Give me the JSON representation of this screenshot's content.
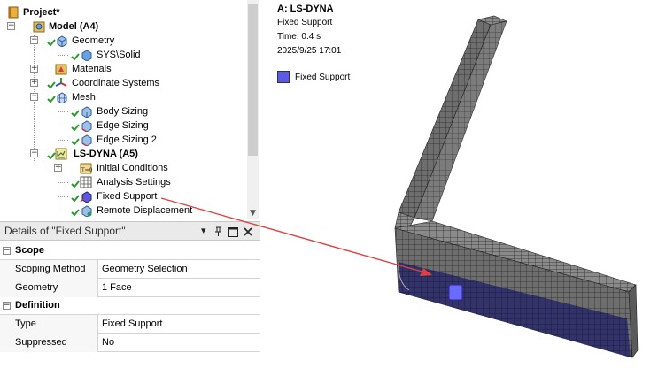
{
  "tree": {
    "items": [
      {
        "label": "Project*",
        "bold": true
      },
      {
        "label": "Model (A4)",
        "bold": true
      },
      {
        "label": "Geometry"
      },
      {
        "label": "SYS\\Solid"
      },
      {
        "label": "Materials"
      },
      {
        "label": "Coordinate Systems"
      },
      {
        "label": "Mesh"
      },
      {
        "label": "Body Sizing"
      },
      {
        "label": "Edge Sizing"
      },
      {
        "label": "Edge Sizing 2"
      },
      {
        "label": "LS-DYNA (A5)",
        "bold": true
      },
      {
        "label": "Initial Conditions"
      },
      {
        "label": "Analysis Settings"
      },
      {
        "label": "Fixed Support"
      },
      {
        "label": "Remote Displacement"
      }
    ]
  },
  "details": {
    "title": "Details of \"Fixed Support\"",
    "pin_icon": "pin-icon",
    "groups": [
      {
        "name": "Scope",
        "rows": [
          {
            "label": "Scoping Method",
            "value": "Geometry Selection"
          },
          {
            "label": "Geometry",
            "value": "1 Face"
          }
        ]
      },
      {
        "name": "Definition",
        "rows": [
          {
            "label": "Type",
            "value": "Fixed Support"
          },
          {
            "label": "Suppressed",
            "value": "No"
          }
        ]
      }
    ]
  },
  "graphics": {
    "analysis": "A: LS-DYNA",
    "object": "Fixed Support",
    "time": "Time: 0.4 s",
    "datetime": "2025/9/25 17:01",
    "legend_label": "Fixed Support",
    "legend_color": "#5a5ae6"
  },
  "colors": {
    "accent_arrow": "#e04040",
    "check_green": "#2a9a2a"
  }
}
